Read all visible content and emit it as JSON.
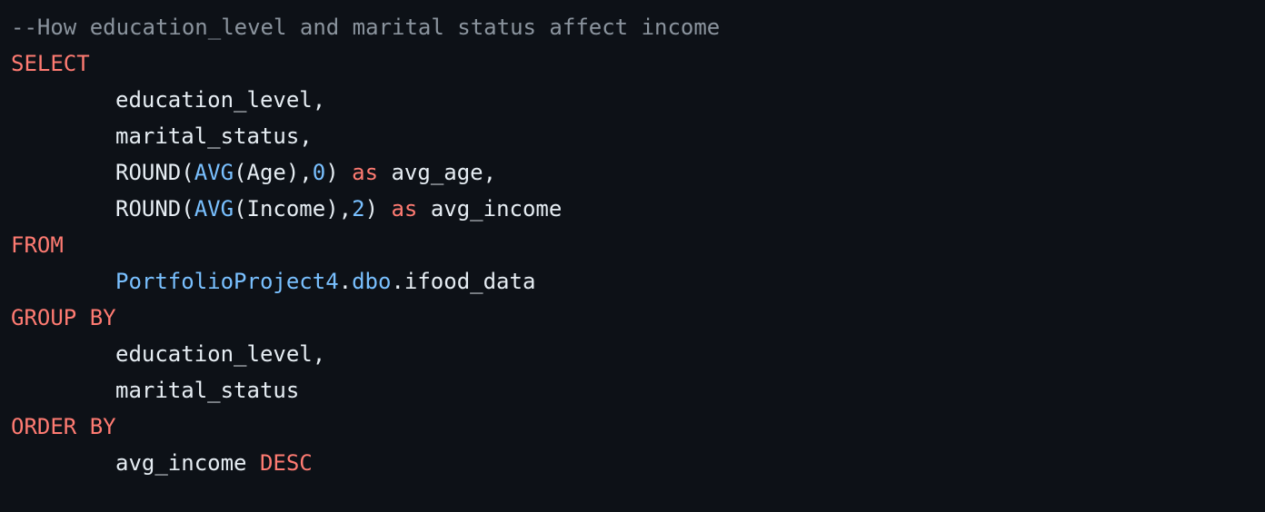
{
  "colors": {
    "background": "#0d1117",
    "comment": "#8b949e",
    "keyword": "#ff7b72",
    "function": "#79c0ff",
    "plain": "#e6edf3"
  },
  "code": {
    "comment": "--How education_level and marital status affect income",
    "select": "SELECT",
    "col1": "education_level,",
    "col2": "marital_status,",
    "round": "ROUND(",
    "avg": "AVG",
    "age_arg": "(Age),",
    "zero": "0",
    "close_paren": ")",
    "as": "as",
    "avg_age": "avg_age,",
    "income_arg": "(Income),",
    "two": "2",
    "avg_income_alias": "avg_income",
    "from": "FROM",
    "db": "PortfolioProject4",
    "dot1": ".",
    "schema": "dbo",
    "dot2": ".",
    "table": "ifood_data",
    "group_by": "GROUP BY",
    "grp_col1": "education_level,",
    "grp_col2": "marital_status",
    "order_by": "ORDER BY",
    "order_col": "avg_income",
    "desc": "DESC"
  }
}
